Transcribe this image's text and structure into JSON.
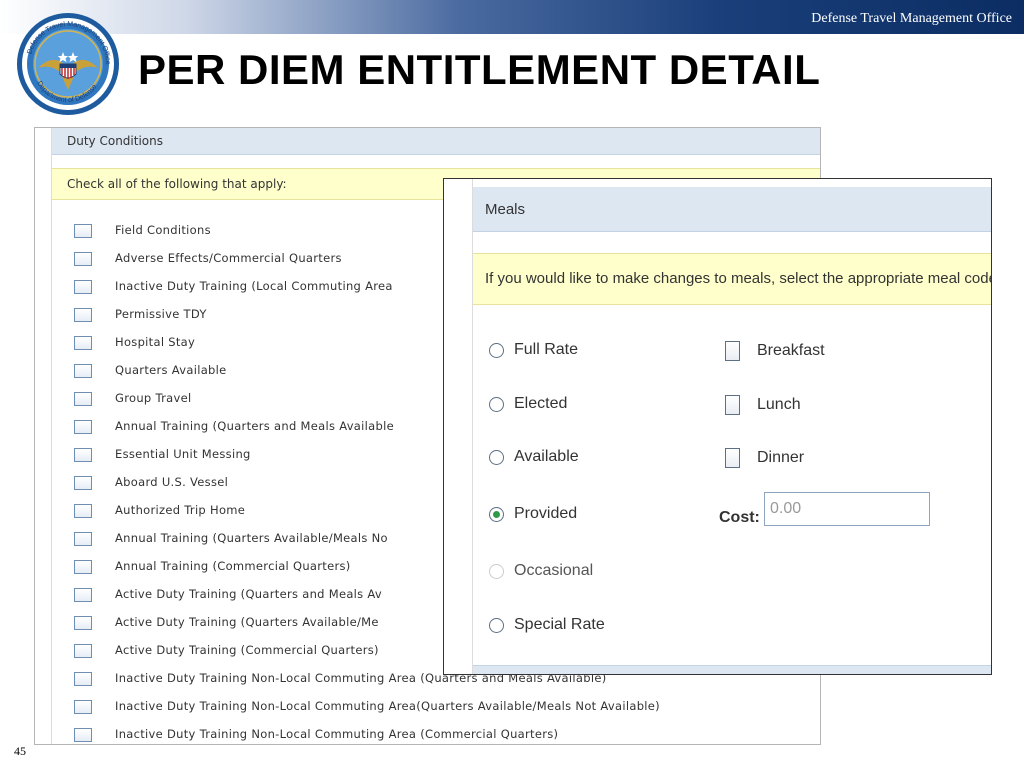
{
  "header": {
    "org": "Defense Travel Management Office",
    "title": "PER DIEM ENTITLEMENT DETAIL",
    "seal_text": "Defense Travel Management Office · Department of Defense"
  },
  "page_number": "45",
  "duty": {
    "header": "Duty Conditions",
    "instruction": "Check all of the following that apply:",
    "items": [
      {
        "label": "Field Conditions",
        "checked": false
      },
      {
        "label": "Adverse Effects/Commercial Quarters",
        "checked": false
      },
      {
        "label": "Inactive Duty Training (Local Commuting Area",
        "checked": false
      },
      {
        "label": "Permissive TDY",
        "checked": false
      },
      {
        "label": "Hospital Stay",
        "checked": false
      },
      {
        "label": "Quarters Available",
        "checked": false
      },
      {
        "label": "Group Travel",
        "checked": false
      },
      {
        "label": "Annual Training (Quarters and Meals Available",
        "checked": false
      },
      {
        "label": "Essential Unit Messing",
        "checked": false
      },
      {
        "label": "Aboard U.S. Vessel",
        "checked": false
      },
      {
        "label": "Authorized Trip Home",
        "checked": false
      },
      {
        "label": "Annual Training (Quarters Available/Meals No",
        "checked": false
      },
      {
        "label": "Annual Training (Commercial Quarters)",
        "checked": false
      },
      {
        "label": "Active Duty Training (Quarters and Meals Av",
        "checked": false
      },
      {
        "label": "Active Duty Training (Quarters Available/Me",
        "checked": false
      },
      {
        "label": "Active Duty Training (Commercial Quarters)",
        "checked": false
      },
      {
        "label": "Inactive Duty Training Non-Local Commuting Area (Quarters and Meals Available)",
        "checked": false
      },
      {
        "label": "Inactive Duty Training Non-Local Commuting Area(Quarters Available/Meals Not Available)",
        "checked": false
      },
      {
        "label": "Inactive Duty Training Non-Local Commuting Area (Commercial Quarters)",
        "checked": false
      }
    ]
  },
  "meals": {
    "header": "Meals",
    "instruction": "If you would like to make changes to meals, select the appropriate meal code and applica",
    "rate_options": [
      {
        "label": "Full Rate",
        "selected": false,
        "disabled": false
      },
      {
        "label": "Elected",
        "selected": false,
        "disabled": false
      },
      {
        "label": "Available",
        "selected": false,
        "disabled": false
      },
      {
        "label": "Provided",
        "selected": true,
        "disabled": false
      },
      {
        "label": "Occasional",
        "selected": false,
        "disabled": true
      },
      {
        "label": "Special Rate",
        "selected": false,
        "disabled": false
      }
    ],
    "meal_checks": [
      {
        "label": "Breakfast",
        "checked": false
      },
      {
        "label": "Lunch",
        "checked": false
      },
      {
        "label": "Dinner",
        "checked": false
      }
    ],
    "cost_label": "Cost:",
    "cost_value": "0.00"
  },
  "colors": {
    "header_blue": "#dde7f2",
    "instruction_yellow": "#ffffcc",
    "selected_radio": "#2f9a4a",
    "navy_band": "#0b2d63"
  }
}
